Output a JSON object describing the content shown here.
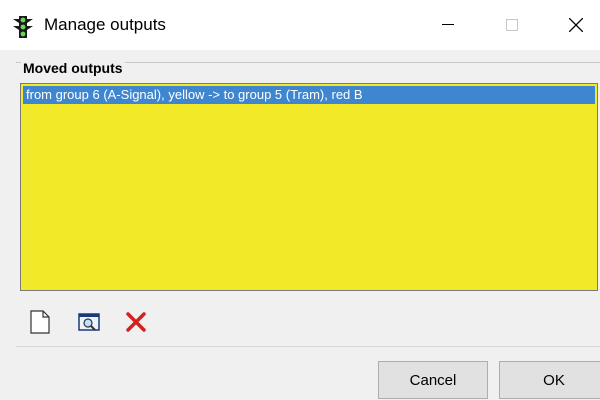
{
  "window": {
    "title": "Manage outputs",
    "icon": "traffic-light-icon"
  },
  "group": {
    "label": "Moved outputs",
    "background": "#f2ea28",
    "items": [
      {
        "label": "from group 6 (A-Signal), yellow  -> to group 5 (Tram), red B",
        "selected": true
      }
    ]
  },
  "toolbar": [
    {
      "icon": "new-document-icon"
    },
    {
      "icon": "zoom-view-icon"
    },
    {
      "icon": "delete-icon"
    }
  ],
  "buttons": {
    "cancel": "Cancel",
    "ok": "OK"
  },
  "colors": {
    "selection": "#3f86d1",
    "delete": "#d42020"
  }
}
